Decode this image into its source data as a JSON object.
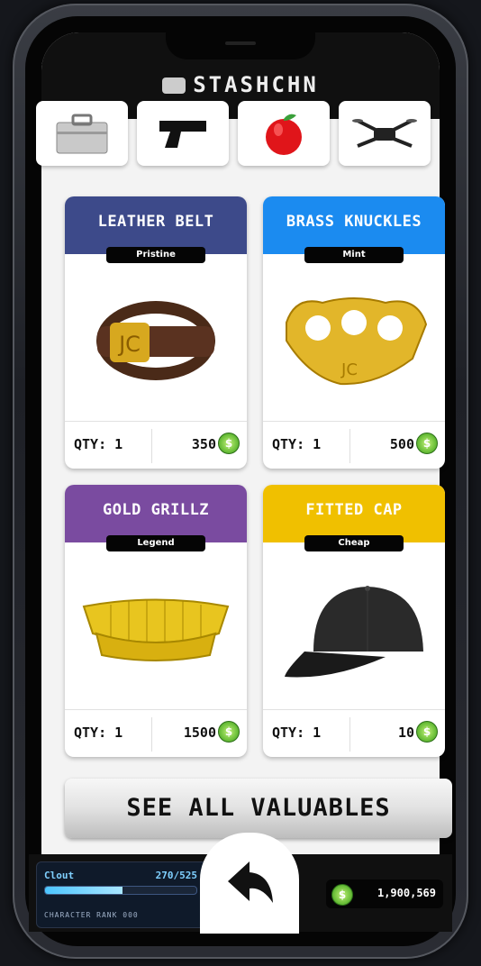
{
  "app": {
    "title": "STASHCHN"
  },
  "categories": [
    {
      "icon": "briefcase-icon"
    },
    {
      "icon": "pistol-icon"
    },
    {
      "icon": "apple-icon"
    },
    {
      "icon": "drone-icon"
    }
  ],
  "items": [
    {
      "name": "LEATHER BELT",
      "rarity": "Pristine",
      "qty": "QTY: 1",
      "price": "350",
      "color": "#3d4a8a",
      "icon": "leather-belt-icon"
    },
    {
      "name": "BRASS KNUCKLES",
      "rarity": "Mint",
      "qty": "QTY: 1",
      "price": "500",
      "color": "#1b8bf0",
      "icon": "brass-knuckles-icon"
    },
    {
      "name": "GOLD GRILLZ",
      "rarity": "Legend",
      "qty": "QTY: 1",
      "price": "1500",
      "color": "#7a4ba0",
      "icon": "gold-grillz-icon"
    },
    {
      "name": "FITTED CAP",
      "rarity": "Cheap",
      "qty": "QTY: 1",
      "price": "10",
      "color": "#f0c000",
      "icon": "fitted-cap-icon"
    }
  ],
  "see_all_label": "SEE ALL VALUABLES",
  "status": {
    "cloud_label": "Clout",
    "cloud_value": "270/525",
    "cloud_progress": 0.51,
    "subtitle": "CHARACTER RANK 000"
  },
  "wallet": {
    "amount": "1,900,569",
    "coin_icon": "coin-icon"
  },
  "back_icon": "back-arrow-icon"
}
